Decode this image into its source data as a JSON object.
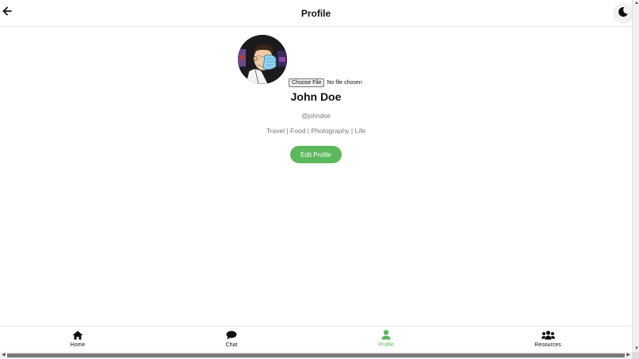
{
  "header": {
    "title": "Profile",
    "back_icon": "arrow-left-icon",
    "theme_icon": "moon-icon"
  },
  "profile": {
    "avatar_icon": "avatar-masked-man",
    "file_button": "Choose File",
    "file_status": "No file chosen",
    "name": "John Doe",
    "handle": "@johndoe",
    "bio": "Travel | Food | Photography | Life",
    "edit_label": "Edit Profile"
  },
  "nav": {
    "items": [
      {
        "label": "Home",
        "icon": "home-icon",
        "active": false
      },
      {
        "label": "Chat",
        "icon": "chat-icon",
        "active": false
      },
      {
        "label": "Profile",
        "icon": "user-icon",
        "active": true
      },
      {
        "label": "Resources",
        "icon": "users-icon",
        "active": false
      }
    ]
  },
  "colors": {
    "accent": "#5cb85c",
    "text": "#111111",
    "muted": "#777777"
  }
}
